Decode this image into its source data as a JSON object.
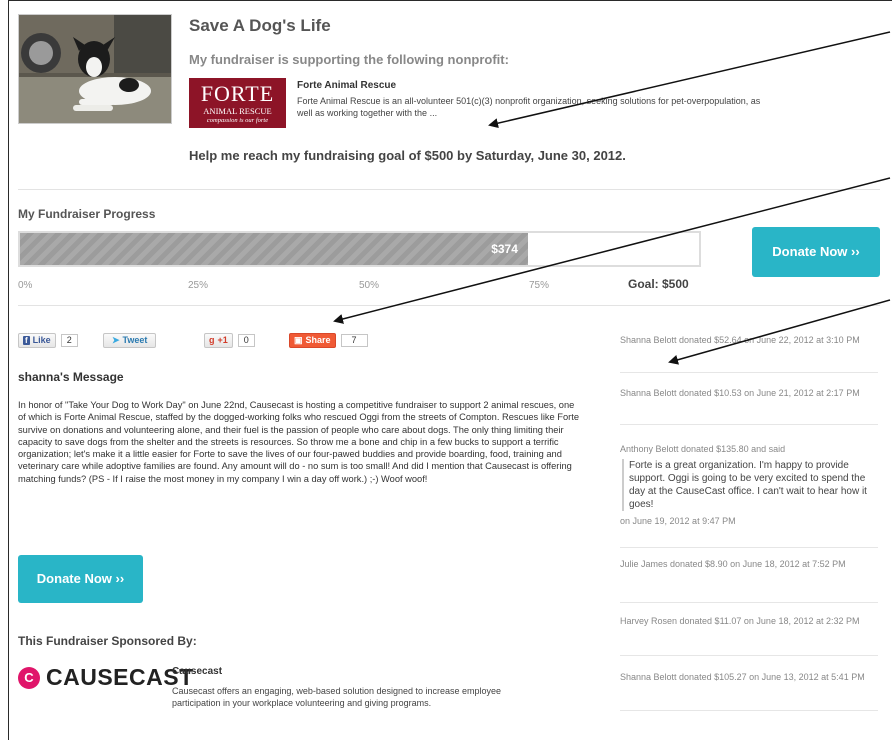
{
  "page": {
    "title": "Save A Dog's Life",
    "nonprofit_intro": "My fundraiser is supporting the following nonprofit:",
    "goal_text": "Help me reach my fundraising goal of $500 by Saturday, June 30, 2012."
  },
  "nonprofit": {
    "logo_big": "FORTE",
    "logo_small": "ANIMAL RESCUE",
    "logo_tagline": "compassion is our forte",
    "name": "Forte Animal Rescue",
    "description": "Forte Animal Rescue is an all-volunteer 501(c)(3) nonprofit organization, seeking solutions for pet-overpopulation, as well as working together with the ..."
  },
  "progress": {
    "label": "My Fundraiser Progress",
    "raised": "$374",
    "fraction": 0.748,
    "ticks": [
      "0%",
      "25%",
      "50%",
      "75%"
    ],
    "goal_label": "Goal: $500"
  },
  "buttons": {
    "donate_label": "Donate Now ››"
  },
  "social": {
    "like_label": "Like",
    "like_count": "2",
    "tweet_label": "Tweet",
    "plusone_label": "+1",
    "plusone_count": "0",
    "share_label": "Share",
    "share_count": "7"
  },
  "message": {
    "title": "shanna's Message",
    "body": "In honor of \"Take Your Dog to Work Day\" on June 22nd, Causecast is hosting a competitive fundraiser to support 2 animal rescues, one of which is Forte Animal Rescue, staffed by the dogged-working folks who rescued Oggi from the streets of Compton. Rescues like Forte survive on donations and volunteering alone, and their fuel is the passion of people who care about dogs. The only thing limiting their capacity to save dogs from the shelter and the streets is resources. So throw me a bone and chip in a few bucks to support a terrific organization; let's make it a little easier for Forte to save the lives of our four-pawed buddies and provide boarding, food, training and veterinary care while adoptive families are found. Any amount will do - no sum is too small! And did I mention that Causecast is offering matching funds? (PS - If I raise the most money in my company I win a day off work.) ;-) Woof woof!"
  },
  "sponsor": {
    "title": "This Fundraiser Sponsored By:",
    "logo_letter": "C",
    "logo_text": "CAUSECAST",
    "name": "Causecast",
    "description": "Causecast offers an engaging, web-based solution designed to increase employee participation in your workplace volunteering and giving programs."
  },
  "donations": [
    {
      "text": "Shanna Belott donated $52.64 on June 22, 2012 at 3:10 PM"
    },
    {
      "text": "Shanna Belott donated $10.53 on June 21, 2012 at 2:17 PM"
    },
    {
      "text": "Anthony Belott donated $135.80 and said",
      "quote": "Forte is a great organization. I'm happy to provide support. Oggi is going to be very excited to spend the day at the CauseCast office. I can't wait to hear how it goes!",
      "after": "on June 19, 2012 at 9:47 PM"
    },
    {
      "text": "Julie James donated $8.90 on June 18, 2012 at 7:52 PM"
    },
    {
      "text": "Harvey Rosen donated $11.07 on June 18, 2012 at 2:32 PM"
    },
    {
      "text": "Shanna Belott donated $105.27 on June 13, 2012 at 5:41 PM"
    }
  ],
  "colors": {
    "accent": "#29b5c7",
    "nonprofit_brand": "#8d1427",
    "sponsor_brand": "#e0156a"
  }
}
